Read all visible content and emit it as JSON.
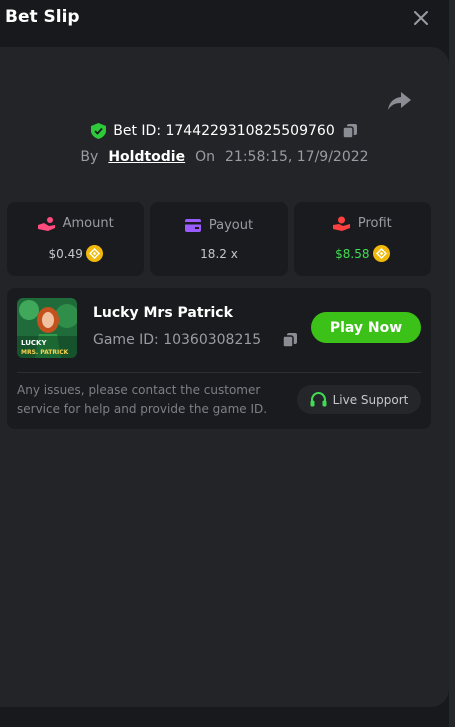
{
  "header": {
    "title": "Bet Slip",
    "close_icon": "close-icon"
  },
  "bet": {
    "id_text": "Bet ID: 1744229310825509760",
    "by_label": "By",
    "user": "Holdtodie",
    "on_label": "On",
    "datetime": "21:58:15, 17/9/2022"
  },
  "stats": {
    "amount": {
      "label": "Amount",
      "value": "$0.49",
      "icon": "hand-coins-icon"
    },
    "payout": {
      "label": "Payout",
      "value": "18.2 x",
      "icon": "wallet-icon"
    },
    "profit": {
      "label": "Profit",
      "value": "$8.58",
      "icon": "profit-hand-icon"
    }
  },
  "game": {
    "name": "Lucky Mrs Patrick",
    "id_text": "Game ID: 10360308215",
    "play_label": "Play Now",
    "thumb_text_1": "LUCKY",
    "thumb_text_2": "MRS. PATRICK"
  },
  "support": {
    "issues_text": "Any issues, please contact the customer service for help and provide the game ID.",
    "button_label": "Live Support"
  },
  "colors": {
    "accent_green": "#3bc117",
    "profit_green": "#3fdd53",
    "coin_gold": "#f0b90b",
    "shield_green": "#2ec93a"
  }
}
